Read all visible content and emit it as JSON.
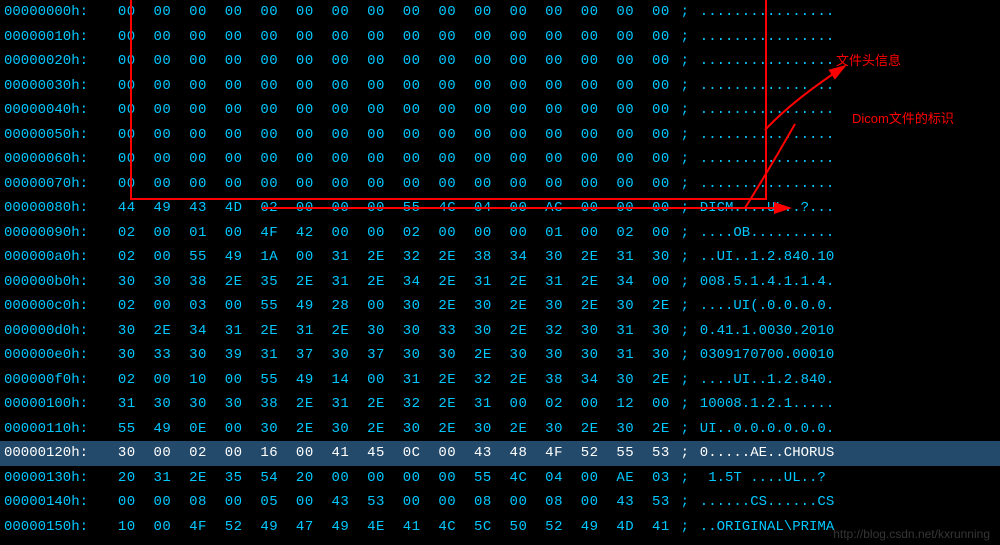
{
  "rows": [
    {
      "offset": "00000000h:",
      "hex": "00 00 00 00 00 00 00 00 00 00 00 00 00 00 00 00",
      "sep": ";",
      "ascii": "................"
    },
    {
      "offset": "00000010h:",
      "hex": "00 00 00 00 00 00 00 00 00 00 00 00 00 00 00 00",
      "sep": ";",
      "ascii": "................"
    },
    {
      "offset": "00000020h:",
      "hex": "00 00 00 00 00 00 00 00 00 00 00 00 00 00 00 00",
      "sep": ";",
      "ascii": "................"
    },
    {
      "offset": "00000030h:",
      "hex": "00 00 00 00 00 00 00 00 00 00 00 00 00 00 00 00",
      "sep": ";",
      "ascii": "................"
    },
    {
      "offset": "00000040h:",
      "hex": "00 00 00 00 00 00 00 00 00 00 00 00 00 00 00 00",
      "sep": ";",
      "ascii": "................"
    },
    {
      "offset": "00000050h:",
      "hex": "00 00 00 00 00 00 00 00 00 00 00 00 00 00 00 00",
      "sep": ";",
      "ascii": "................"
    },
    {
      "offset": "00000060h:",
      "hex": "00 00 00 00 00 00 00 00 00 00 00 00 00 00 00 00",
      "sep": ";",
      "ascii": "................"
    },
    {
      "offset": "00000070h:",
      "hex": "00 00 00 00 00 00 00 00 00 00 00 00 00 00 00 00",
      "sep": ";",
      "ascii": "................"
    },
    {
      "offset": "00000080h:",
      "hex": "44 49 43 4D 02 00 00 00 55 4C 04 00 AC 00 00 00",
      "sep": ";",
      "ascii": "DICM....UL..?..."
    },
    {
      "offset": "00000090h:",
      "hex": "02 00 01 00 4F 42 00 00 02 00 00 00 01 00 02 00",
      "sep": ";",
      "ascii": "....OB.........."
    },
    {
      "offset": "000000a0h:",
      "hex": "02 00 55 49 1A 00 31 2E 32 2E 38 34 30 2E 31 30",
      "sep": ";",
      "ascii": "..UI..1.2.840.10"
    },
    {
      "offset": "000000b0h:",
      "hex": "30 30 38 2E 35 2E 31 2E 34 2E 31 2E 31 2E 34 00",
      "sep": ";",
      "ascii": "008.5.1.4.1.1.4."
    },
    {
      "offset": "000000c0h:",
      "hex": "02 00 03 00 55 49 28 00 30 2E 30 2E 30 2E 30 2E",
      "sep": ";",
      "ascii": "....UI(.0.0.0.0."
    },
    {
      "offset": "000000d0h:",
      "hex": "30 2E 34 31 2E 31 2E 30 30 33 30 2E 32 30 31 30",
      "sep": ";",
      "ascii": "0.41.1.0030.2010"
    },
    {
      "offset": "000000e0h:",
      "hex": "30 33 30 39 31 37 30 37 30 30 2E 30 30 30 31 30",
      "sep": ";",
      "ascii": "0309170700.00010"
    },
    {
      "offset": "000000f0h:",
      "hex": "02 00 10 00 55 49 14 00 31 2E 32 2E 38 34 30 2E",
      "sep": ";",
      "ascii": "....UI..1.2.840."
    },
    {
      "offset": "00000100h:",
      "hex": "31 30 30 30 38 2E 31 2E 32 2E 31 00 02 00 12 00",
      "sep": ";",
      "ascii": "10008.1.2.1....."
    },
    {
      "offset": "00000110h:",
      "hex": "55 49 0E 00 30 2E 30 2E 30 2E 30 2E 30 2E 30 2E",
      "sep": ";",
      "ascii": "UI..0.0.0.0.0.0."
    },
    {
      "offset": "00000120h:",
      "hex": "30 00 02 00 16 00 41 45 0C 00 43 48 4F 52 55 53",
      "sep": ";",
      "ascii": "0.....AE..CHORUS",
      "highlight": true
    },
    {
      "offset": "00000130h:",
      "hex": "20 31 2E 35 54 20 00 00 00 00 55 4C 04 00 AE 03",
      "sep": ";",
      "ascii": " 1.5T ....UL..?"
    },
    {
      "offset": "00000140h:",
      "hex": "00 00 08 00 05 00 43 53 00 00 08 00 08 00 43 53",
      "sep": ";",
      "ascii": "......CS......CS"
    },
    {
      "offset": "00000150h:",
      "hex": "10 00 4F 52 49 47 49 4E 41 4C 5C 50 52 49 4D 41",
      "sep": ";",
      "ascii": "..ORIGINAL\\PRIMA"
    }
  ],
  "annotations": {
    "label_header": "文件头信息",
    "label_dicom": "Dicom文件的标识"
  },
  "watermark": "http://blog.csdn.net/kxrunning"
}
